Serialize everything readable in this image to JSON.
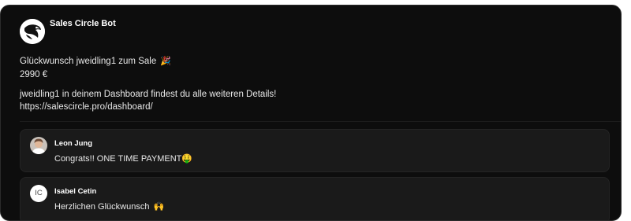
{
  "bot": {
    "name": "Sales Circle Bot",
    "avatar_icon": "eagle-logo-icon"
  },
  "post": {
    "line1": "Glückwunsch jweidling1 zum Sale",
    "line1_emoji": "🎉",
    "amount": "2990 €",
    "line3": "jweidling1 in deinem Dashboard findest du alle weiteren Details!",
    "link": "https://salescircle.pro/dashboard/"
  },
  "replies": [
    {
      "author": "Leon Jung",
      "text": "Congrats!! ONE TIME PAYMENT",
      "emoji": "🤑",
      "avatar": "photo"
    },
    {
      "author": "Isabel Cetin",
      "initials": "IC",
      "text": "Herzlichen Glückwunsch",
      "emoji": "🙌",
      "avatar": "initials"
    }
  ]
}
